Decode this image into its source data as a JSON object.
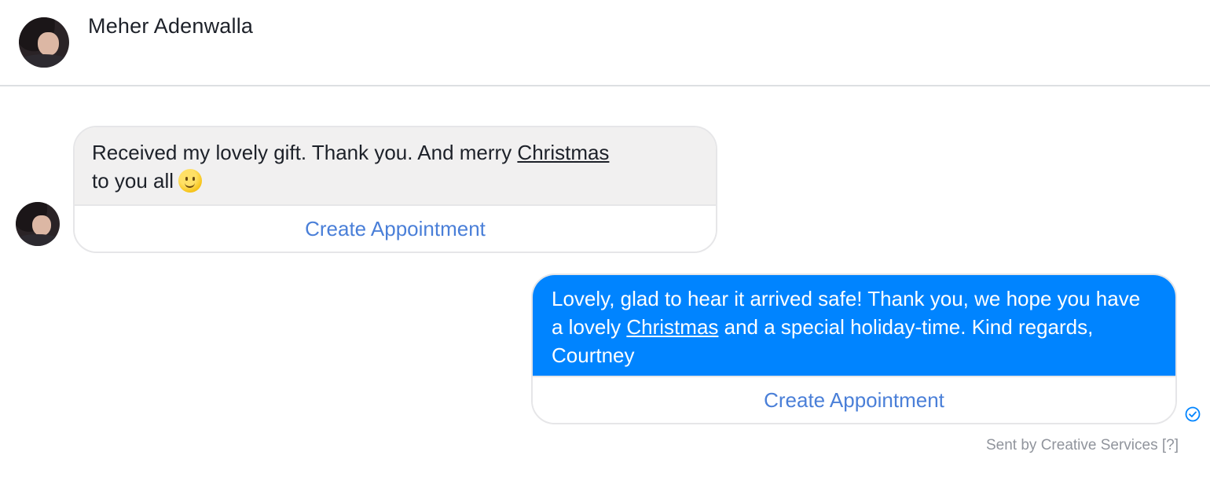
{
  "header": {
    "contact_name": "Meher Adenwalla"
  },
  "messages": [
    {
      "direction": "incoming",
      "text_before_link": "Received my lovely gift. Thank you. And merry ",
      "link_text": "Christmas",
      "text_after_link": " to you all",
      "emoji": "slightly-smiling-face",
      "action_label": "Create Appointment"
    },
    {
      "direction": "outgoing",
      "text_before_link": "Lovely, glad to hear it arrived safe! Thank you, we hope you have a lovely ",
      "link_text": "Christmas",
      "text_after_link": " and a special holiday-time. Kind regards, Courtney",
      "action_label": "Create Appointment"
    }
  ],
  "footer": {
    "sent_by": "Sent by Creative Services",
    "help_link": "[?]"
  },
  "colors": {
    "outgoing_bubble": "#0084ff",
    "incoming_bubble": "#f1f0f0",
    "action_text": "#4a7fd8",
    "meta_text": "#90949c"
  },
  "icons": {
    "seen": "seen-check-icon"
  }
}
